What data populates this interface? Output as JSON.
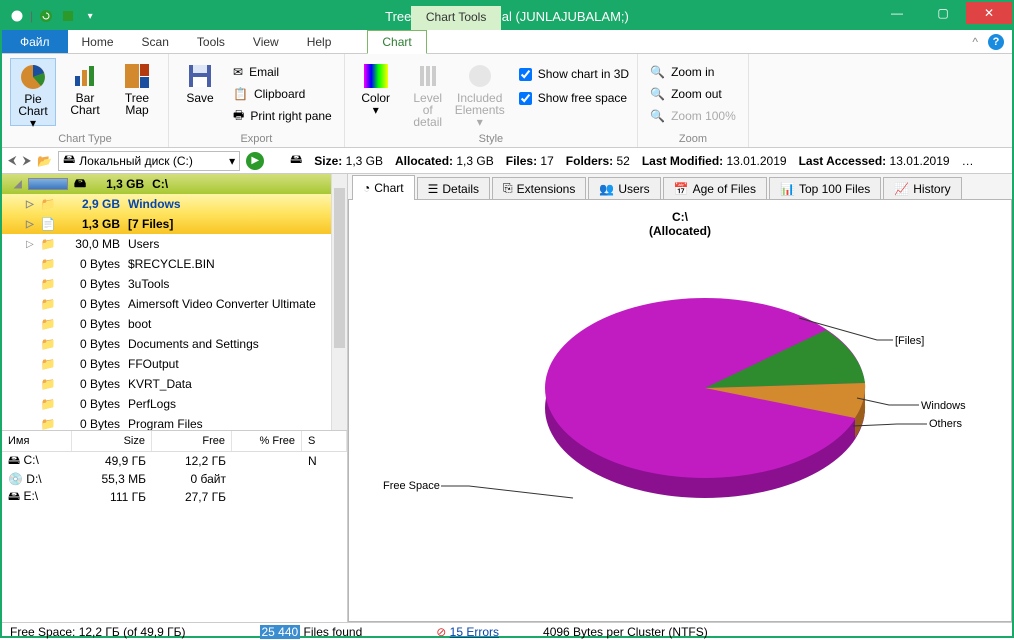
{
  "window": {
    "title": "TreeSize Professional  (JUNLAJUBALAM;)",
    "chart_tools": "Chart Tools"
  },
  "ribbon": {
    "tabs": {
      "file": "Файл",
      "home": "Home",
      "scan": "Scan",
      "tools": "Tools",
      "view": "View",
      "help": "Help",
      "chart": "Chart"
    },
    "groups": {
      "chart_type": "Chart Type",
      "export": "Export",
      "style": "Style",
      "zoom": "Zoom"
    },
    "buttons": {
      "pie_chart": "Pie Chart ▾",
      "bar_chart": "Bar Chart",
      "tree_map": "Tree Map",
      "save": "Save",
      "email": "Email",
      "clipboard": "Clipboard",
      "print": "Print right pane",
      "color": "Color ▾",
      "level_detail": "Level of detail",
      "included": "Included Elements ▾",
      "show3d": "Show chart in 3D",
      "showfree": "Show free space",
      "zoom_in": "Zoom in",
      "zoom_out": "Zoom out",
      "zoom100": "Zoom 100%"
    }
  },
  "nav": {
    "drive": "Локальный диск (C:)",
    "size_label": "Size:",
    "size": "1,3 GB",
    "alloc_label": "Allocated:",
    "alloc": "1,3 GB",
    "files_label": "Files:",
    "files": "17",
    "folders_label": "Folders:",
    "folders": "52",
    "lm_label": "Last Modified:",
    "lm": "13.01.2019",
    "la_label": "Last Accessed:",
    "la": "13.01.2019"
  },
  "tree": {
    "root": {
      "size": "1,3 GB",
      "name": "C:\\"
    },
    "items": [
      {
        "size": "2,9 GB",
        "name": "Windows",
        "style": "win"
      },
      {
        "size": "1,3 GB",
        "name": "[7 Files]",
        "style": "files"
      },
      {
        "size": "30,0 MB",
        "name": "Users"
      },
      {
        "size": "0 Bytes",
        "name": "$RECYCLE.BIN"
      },
      {
        "size": "0 Bytes",
        "name": "3uTools"
      },
      {
        "size": "0 Bytes",
        "name": "Aimersoft Video Converter Ultimate"
      },
      {
        "size": "0 Bytes",
        "name": "boot"
      },
      {
        "size": "0 Bytes",
        "name": "Documents and Settings"
      },
      {
        "size": "0 Bytes",
        "name": "FFOutput"
      },
      {
        "size": "0 Bytes",
        "name": "KVRT_Data"
      },
      {
        "size": "0 Bytes",
        "name": "PerfLogs"
      },
      {
        "size": "0 Bytes",
        "name": "Program Files"
      }
    ]
  },
  "drives": {
    "headers": {
      "name": "Имя",
      "size": "Size",
      "free": "Free",
      "pfree": "% Free",
      "s": "S"
    },
    "rows": [
      {
        "name": "C:\\",
        "size": "49,9 ГБ",
        "free": "12,2 ГБ",
        "pfree": "",
        "s": "N"
      },
      {
        "name": "D:\\",
        "size": "55,3 МБ",
        "free": "0 байт",
        "pfree": "",
        "s": ""
      },
      {
        "name": "E:\\",
        "size": "111 ГБ",
        "free": "27,7 ГБ",
        "pfree": "",
        "s": ""
      }
    ]
  },
  "viewtabs": {
    "chart": "Chart",
    "details": "Details",
    "ext": "Extensions",
    "users": "Users",
    "age": "Age of Files",
    "top": "Top 100 Files",
    "hist": "History"
  },
  "chart": {
    "title": "C:\\",
    "sub": "(Allocated)",
    "labels": {
      "files": "[Files]",
      "windows": "Windows",
      "others": "Others",
      "freespace": "Free Space"
    }
  },
  "chart_data": {
    "type": "pie",
    "title": "C:\\ (Allocated)",
    "series": [
      {
        "name": "Free Space",
        "value": 75,
        "color": "#c11cc1"
      },
      {
        "name": "[Files]",
        "value": 11,
        "color": "#2e8b2e"
      },
      {
        "name": "Windows",
        "value": 8,
        "color": "#d38a2e"
      },
      {
        "name": "Others",
        "value": 6,
        "color": "#c11cc1"
      }
    ]
  },
  "status": {
    "free": "Free Space: 12,2 ГБ  (of 49,9 ГБ)",
    "found_n": "25 440",
    "found_t": "Files found",
    "errs": "15 Errors",
    "cluster": "4096  Bytes per Cluster (NTFS)"
  }
}
